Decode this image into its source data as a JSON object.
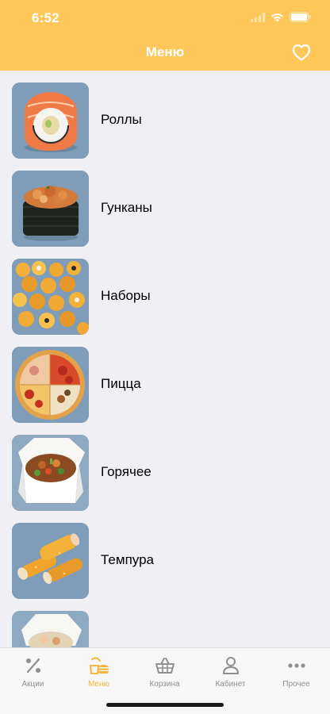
{
  "status_bar": {
    "time": "6:52"
  },
  "header": {
    "title": "Меню",
    "favorite_icon": "heart-outline-icon"
  },
  "menu": {
    "items": [
      {
        "label": "Роллы",
        "image": "rolls-photo"
      },
      {
        "label": "Гунканы",
        "image": "gunkan-photo"
      },
      {
        "label": "Наборы",
        "image": "sets-photo"
      },
      {
        "label": "Пицца",
        "image": "pizza-photo"
      },
      {
        "label": "Горячее",
        "image": "hot-dishes-photo"
      },
      {
        "label": "Темпура",
        "image": "tempura-photo"
      },
      {
        "label": "",
        "image": "next-category-photo"
      }
    ]
  },
  "tabbar": {
    "tabs": [
      {
        "label": "Акции",
        "icon": "percent-icon",
        "active": false
      },
      {
        "label": "Меню",
        "icon": "food-menu-icon",
        "active": true
      },
      {
        "label": "Корзина",
        "icon": "basket-icon",
        "active": false
      },
      {
        "label": "Кабинет",
        "icon": "user-icon",
        "active": false
      },
      {
        "label": "Прочее",
        "icon": "more-dots-icon",
        "active": false
      }
    ]
  },
  "colors": {
    "accent": "#ffc65a",
    "active_tab": "#f7b53e",
    "inactive_tab": "#8e8e93",
    "background": "#efeff4"
  }
}
